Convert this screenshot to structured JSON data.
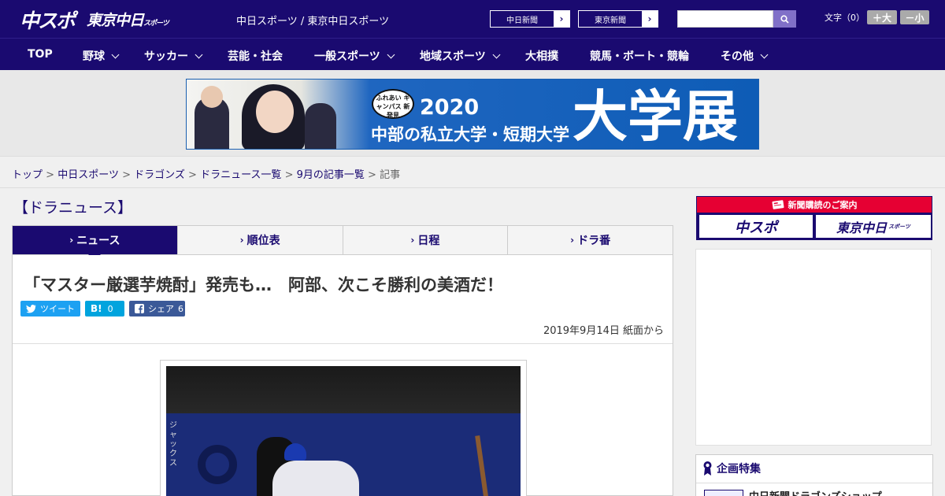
{
  "header": {
    "logo_main": "中スポ",
    "logo_sub": "東京中日",
    "logo_sub_small": "スポーツ",
    "tagline": "中日スポーツ / 東京中日スポーツ",
    "paper_links": [
      {
        "label": "中日新聞"
      },
      {
        "label": "東京新聞"
      }
    ],
    "search": {
      "placeholder": ""
    },
    "font_size": {
      "label": "文字（0）",
      "increase": "＋大",
      "decrease": "－小"
    }
  },
  "nav": {
    "items": [
      {
        "label": "TOP"
      },
      {
        "label": "野球"
      },
      {
        "label": "サッカー"
      },
      {
        "label": "芸能・社会"
      },
      {
        "label": "一般スポーツ"
      },
      {
        "label": "地域スポーツ"
      },
      {
        "label": "大相撲"
      },
      {
        "label": "競馬・ボート・競輪"
      },
      {
        "label": "その他"
      }
    ]
  },
  "banner": {
    "badge": "ふれあい キャンパス 新発見",
    "year": "2020",
    "subtitle": "中部の私立大学・短期大学",
    "big": "大学展"
  },
  "breadcrumb": {
    "items": [
      "トップ",
      "中日スポーツ",
      "ドラゴンズ",
      "ドラニュース一覧",
      "9月の記事一覧"
    ],
    "current": "記事",
    "sep": ">"
  },
  "section_title": "【ドラニュース】",
  "tabs": [
    {
      "label": "ニュース"
    },
    {
      "label": "順位表"
    },
    {
      "label": "日程"
    },
    {
      "label": "ドラ番"
    }
  ],
  "article": {
    "headline": "「マスター厳選芋焼酎」発売も…　阿部、次こそ勝利の美酒だ！",
    "share": {
      "tweet": "ツイート",
      "hatena_icon": "B!",
      "hatena_count": "0",
      "facebook": "シェア",
      "facebook_count": "6"
    },
    "date": "2019年9月14日 紙面から",
    "photo_text": "ジャックス"
  },
  "sidebar": {
    "subscription_title": "新聞購読のご案内",
    "logo1": "中スポ",
    "logo2": "東京中日",
    "logo2_small": "スポーツ",
    "feature_title": "企画特集",
    "feature_item": "中日新聞ドラゴンズショップ"
  },
  "colors": {
    "brand": "#1a0a70",
    "accent_red": "#e60033",
    "twitter": "#1da1f2",
    "hatena": "#00a4de",
    "facebook": "#3b5998"
  }
}
